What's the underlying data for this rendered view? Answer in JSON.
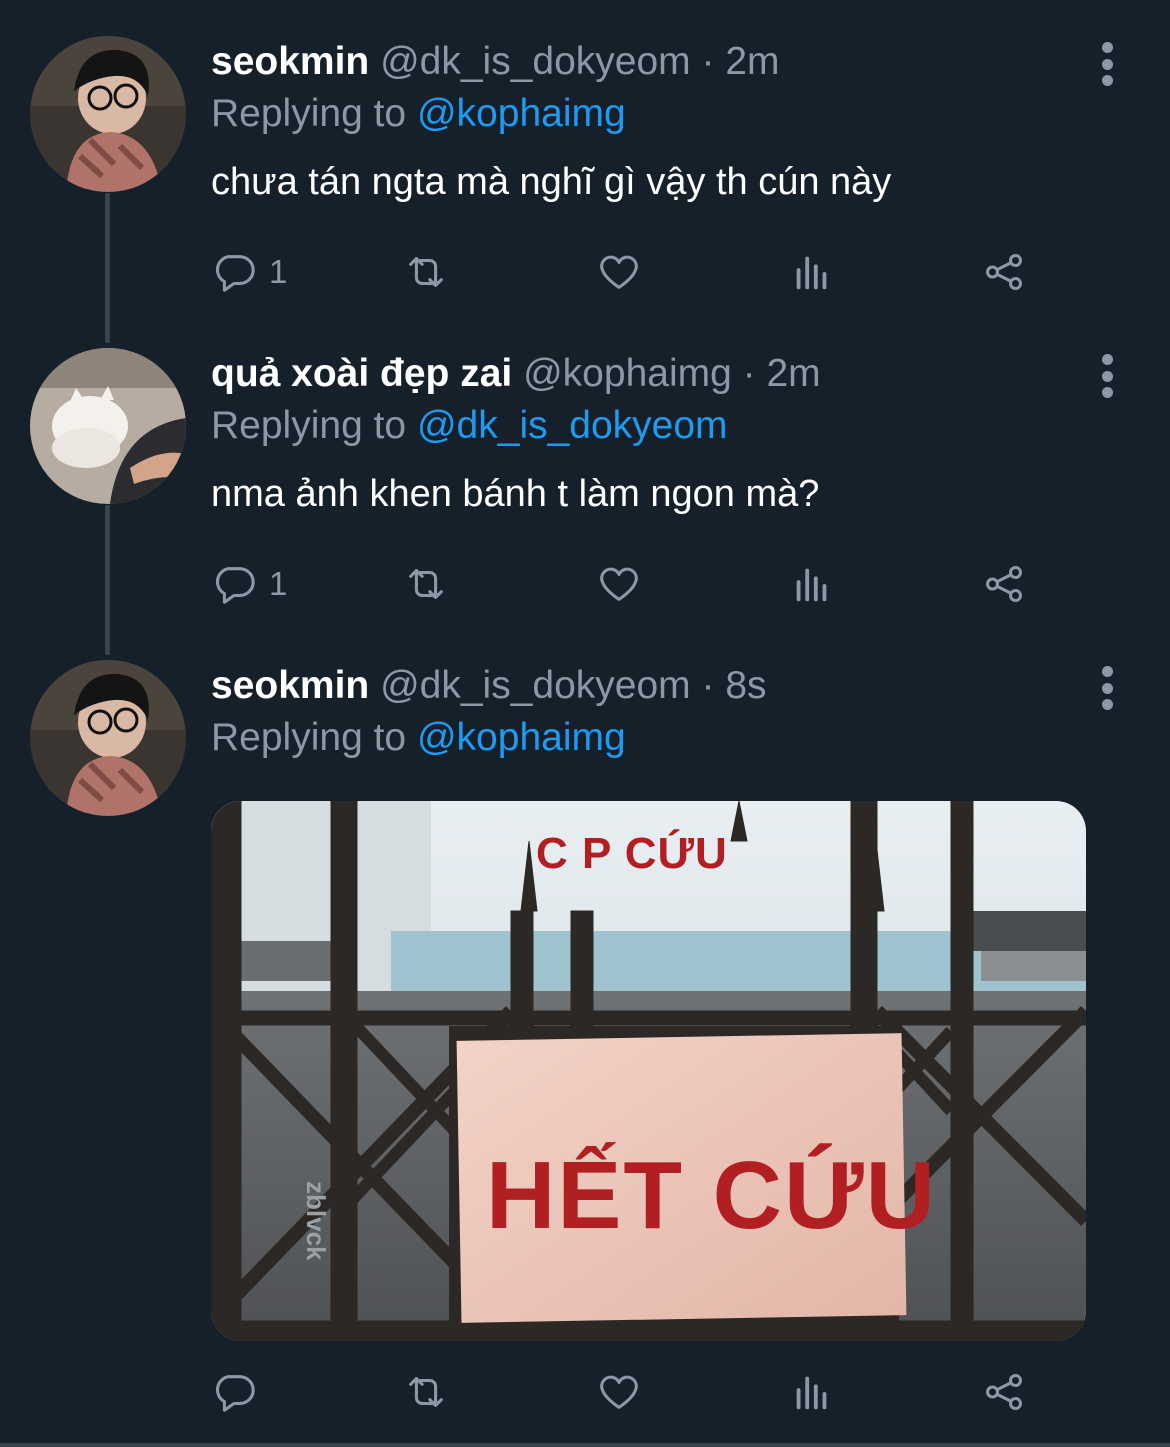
{
  "tweets": [
    {
      "display_name": "seokmin",
      "handle": "@dk_is_dokyeom",
      "separator": "·",
      "time": "2m",
      "replying_prefix": "Replying to",
      "replying_to": "@kophaimg",
      "text": "chưa tán ngta mà nghĩ gì vậy th cún này",
      "reply_count": "1",
      "retweet_count": "",
      "like_count": ""
    },
    {
      "display_name": "quả xoài đẹp zai",
      "handle": "@kophaimg",
      "separator": "·",
      "time": "2m",
      "replying_prefix": "Replying to",
      "replying_to": "@dk_is_dokyeom",
      "text": "nma ảnh khen bánh t làm ngon mà?",
      "reply_count": "1",
      "retweet_count": "",
      "like_count": ""
    },
    {
      "display_name": "seokmin",
      "handle": "@dk_is_dokyeom",
      "separator": "·",
      "time": "8s",
      "replying_prefix": "Replying to",
      "replying_to": "@kophaimg",
      "text": "",
      "reply_count": "",
      "retweet_count": "",
      "like_count": "",
      "media": {
        "sign_text": "HẾT CỨU",
        "background_sign": "C P CỨU",
        "watermark": "zblvck"
      }
    }
  ],
  "icons": {
    "reply": "reply-icon",
    "retweet": "retweet-icon",
    "like": "heart-icon",
    "analytics": "analytics-icon",
    "share": "share-icon",
    "more": "more-vertical-icon"
  },
  "colors": {
    "background": "#15202b",
    "mention": "#1d9bf0",
    "secondary_text": "#8b98a5",
    "sign_red": "#b21f22"
  }
}
